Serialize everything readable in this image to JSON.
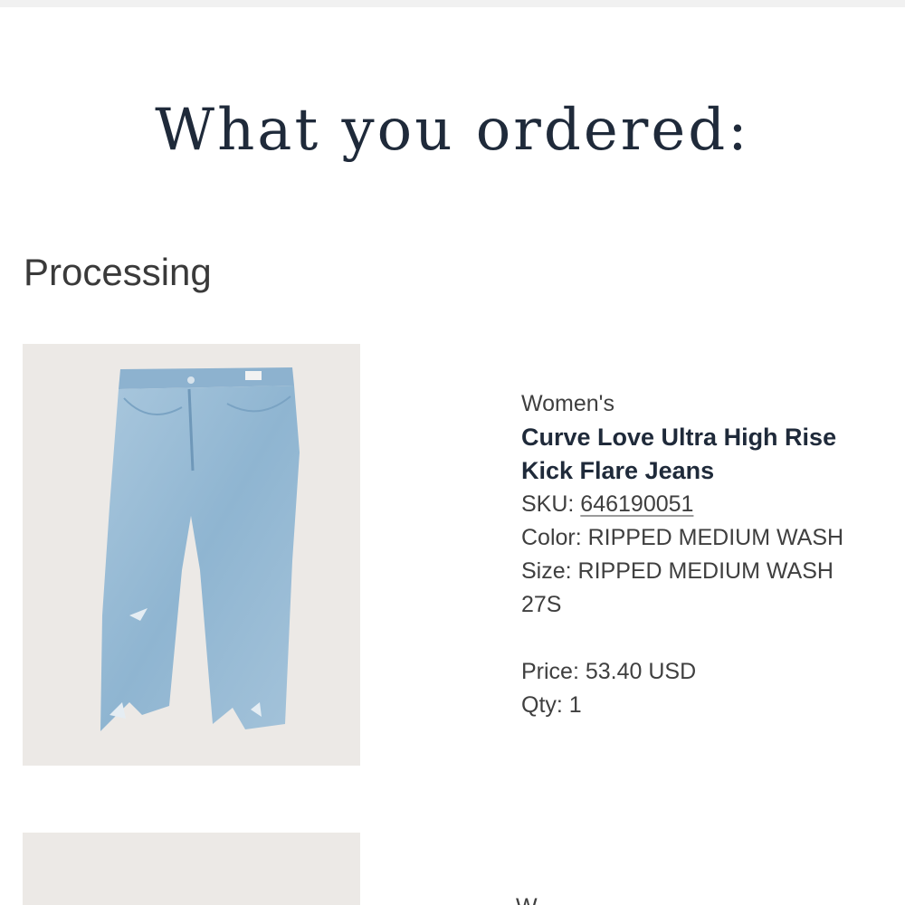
{
  "order": {
    "heading": "What you ordered:",
    "status": "Processing"
  },
  "item": {
    "image_icon": "jeans-product-photo",
    "department": "Women's",
    "name_line1": "Curve Love Ultra High Rise",
    "name_line2": "Kick Flare Jeans",
    "sku_label": "SKU: ",
    "sku_value": "646190051",
    "color_text": "Color: RIPPED MEDIUM WASH",
    "size_text_line1": "Size: RIPPED MEDIUM WASH",
    "size_text_line2": "27S",
    "price_text": "Price: 53.40 USD",
    "qty_text": "Qty: 1"
  },
  "next_item": {
    "image_icon": "product-photo-partial",
    "department_partial": "W"
  },
  "colors": {
    "heading": "#1f2a3a",
    "image_bg": "#ece9e6",
    "denim": "#9fc0d8"
  }
}
